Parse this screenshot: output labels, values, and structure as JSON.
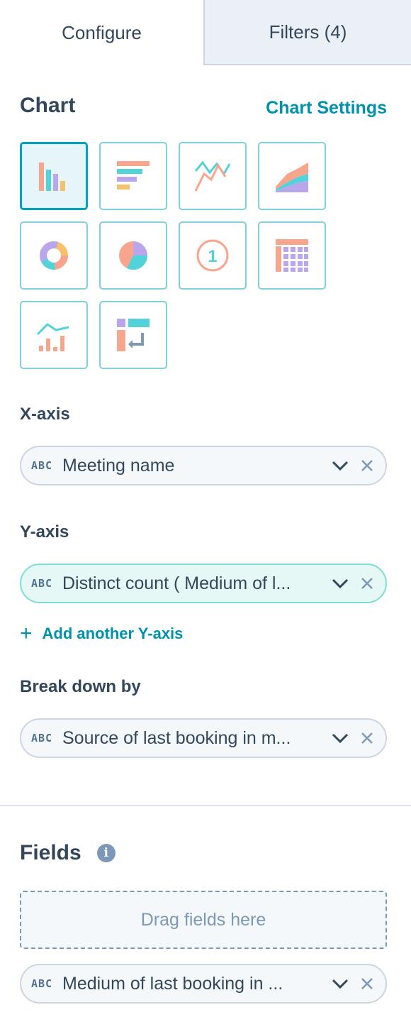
{
  "tabs": [
    {
      "label": "Configure",
      "active": true
    },
    {
      "label": "Filters (4)",
      "active": false
    }
  ],
  "chart": {
    "title": "Chart",
    "settings_link": "Chart Settings",
    "types": [
      {
        "name": "vertical-bar",
        "selected": true
      },
      {
        "name": "horizontal-bar",
        "selected": false
      },
      {
        "name": "line",
        "selected": false
      },
      {
        "name": "area",
        "selected": false
      },
      {
        "name": "donut",
        "selected": false
      },
      {
        "name": "pie",
        "selected": false
      },
      {
        "name": "summary",
        "selected": false
      },
      {
        "name": "pivot-table",
        "selected": false
      },
      {
        "name": "combination",
        "selected": false
      },
      {
        "name": "table",
        "selected": false
      }
    ]
  },
  "x_axis": {
    "label": "X-axis",
    "field": {
      "type_badge": "ABC",
      "text": "Meeting name"
    }
  },
  "y_axis": {
    "label": "Y-axis",
    "field": {
      "type_badge": "ABC",
      "text": "Distinct count ( Medium of l..."
    },
    "add_link": "Add another Y-axis"
  },
  "break_down": {
    "label": "Break down by",
    "field": {
      "type_badge": "ABC",
      "text": "Source of last booking in m..."
    }
  },
  "fields": {
    "title": "Fields",
    "info_glyph": "i",
    "dropzone_text": "Drag fields here",
    "items": [
      {
        "type_badge": "ABC",
        "text": "Medium of last booking in ..."
      }
    ]
  },
  "colors": {
    "accent": "#00a4bd",
    "link": "#0091ae",
    "text": "#33475b",
    "salmon": "#f8a58e",
    "teal": "#51d3d9",
    "purple": "#b9a6ec",
    "yellow": "#f5c26b"
  }
}
